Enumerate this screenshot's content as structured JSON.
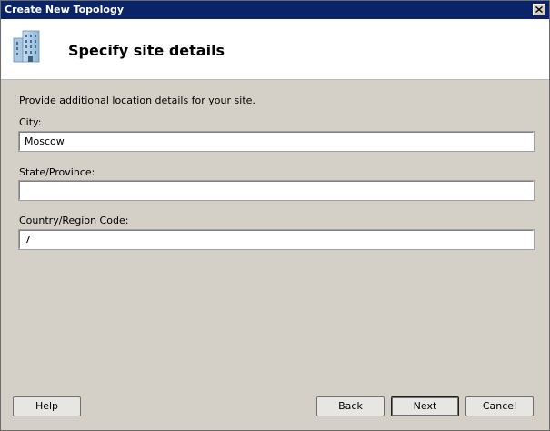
{
  "window": {
    "title": "Create New Topology"
  },
  "header": {
    "title": "Specify site details",
    "icon": "building-icon"
  },
  "instruction": "Provide additional location details for your site.",
  "fields": [
    {
      "label": "City:",
      "value": "Moscow"
    },
    {
      "label": "State/Province:",
      "value": ""
    },
    {
      "label": "Country/Region Code:",
      "value": "7"
    }
  ],
  "buttons": {
    "help": "Help",
    "back": "Back",
    "next": "Next",
    "cancel": "Cancel"
  },
  "colors": {
    "titlebar": "#0a246a",
    "dialog_bg": "#d4d0c8",
    "header_bg": "#ffffff"
  }
}
